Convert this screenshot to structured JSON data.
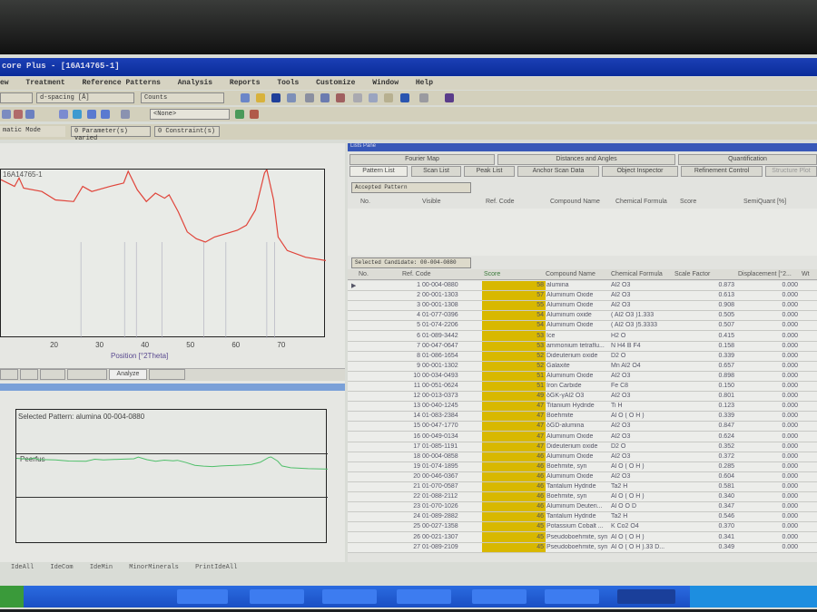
{
  "window": {
    "title": "core Plus - [16A14765-1]"
  },
  "menu": [
    "ew",
    "Treatment",
    "Reference Patterns",
    "Analysis",
    "Reports",
    "Tools",
    "Customize",
    "Window",
    "Help"
  ],
  "toolbar": {
    "dspacing": "d-spacing [Å]",
    "counts": "Counts",
    "none": "<None>",
    "mode": "matic Mode",
    "params": "0 Parameter(s) varied",
    "constraints": "0 Constraint(s)"
  },
  "scan_plot": {
    "sample": "16A14765-1",
    "xlabel": "Position [°2Theta]",
    "xticks": [
      20,
      30,
      40,
      50,
      60,
      70
    ],
    "xrange": [
      8,
      79.5
    ],
    "points": [
      [
        8,
        0.94
      ],
      [
        11,
        0.9
      ],
      [
        12,
        0.95
      ],
      [
        13,
        0.89
      ],
      [
        17,
        0.87
      ],
      [
        20,
        0.82
      ],
      [
        24,
        0.81
      ],
      [
        26,
        0.9
      ],
      [
        28,
        0.87
      ],
      [
        32,
        0.9
      ],
      [
        35,
        0.92
      ],
      [
        36,
        0.99
      ],
      [
        38,
        0.88
      ],
      [
        40,
        0.81
      ],
      [
        42,
        0.86
      ],
      [
        44,
        0.83
      ],
      [
        45,
        0.85
      ],
      [
        47,
        0.75
      ],
      [
        49,
        0.63
      ],
      [
        51,
        0.59
      ],
      [
        53,
        0.57
      ],
      [
        55,
        0.6
      ],
      [
        60,
        0.64
      ],
      [
        62,
        0.67
      ],
      [
        64,
        0.76
      ],
      [
        66,
        0.98
      ],
      [
        66.5,
        1.0
      ],
      [
        68,
        0.82
      ],
      [
        69,
        0.6
      ],
      [
        71,
        0.52
      ],
      [
        75,
        0.48
      ],
      [
        79.5,
        0.46
      ]
    ],
    "line_color": "#e0443a"
  },
  "left_tabs": {
    "analyze": "Analyze"
  },
  "pattern_panel": {
    "selected": "Selected Pattern: alumina 00-004-0880",
    "label": "Peerfus",
    "line_color": "#4fbf6a"
  },
  "bottom_toolbar": [
    "IdeAll",
    "IdeCom",
    "IdeMin",
    "MinorMinerals",
    "PrintIdeAll"
  ],
  "lists_pane": {
    "title": "Lists Pane",
    "tabs_row1": [
      "Fourier Map",
      "Distances and Angles",
      "Quantification"
    ],
    "tabs_row2": [
      "Pattern List",
      "Scan List",
      "Peak List",
      "Anchor Scan Data",
      "Object Inspector",
      "Refinement Control",
      "Structure Plot"
    ],
    "accepted": "Accepted Pattern",
    "accepted_cols": [
      "No.",
      "Visible",
      "Ref. Code",
      "Compound Name",
      "Chemical Formula",
      "Score",
      "SemiQuant [%]"
    ],
    "selected_candidate": "Selected Candidate: 00-004-0880",
    "cols": [
      "No.",
      "Ref. Code",
      "Score",
      "Compound Name",
      "Chemical Formula",
      "Scale Factor",
      "Displacement [°2...",
      "Wt"
    ],
    "score_color": "#d8b800",
    "rows": [
      [
        "1",
        "00-004-0880",
        "58",
        "alumina",
        "Al2 O3",
        "0.873",
        "0.000"
      ],
      [
        "2",
        "00-001-1303",
        "57",
        "Aluminum Oxide",
        "Al2 O3",
        "0.613",
        "0.000"
      ],
      [
        "3",
        "00-001-1308",
        "55",
        "Aluminum Oxide",
        "Al2 O3",
        "0.908",
        "0.000"
      ],
      [
        "4",
        "01-077-0396",
        "54",
        "Aluminum oxide",
        "( Al2 O3 )1.333",
        "0.505",
        "0.000"
      ],
      [
        "5",
        "01-074-2206",
        "54",
        "Aluminum Oxide",
        "( Al2 O3 )5.3333",
        "0.507",
        "0.000"
      ],
      [
        "6",
        "01-089-3442",
        "53",
        "Ice",
        "H2 O",
        "0.415",
        "0.000"
      ],
      [
        "7",
        "00-047-0647",
        "53",
        "ammonium tetraflu...",
        "N H4 B F4",
        "0.158",
        "0.000"
      ],
      [
        "8",
        "01-086-1654",
        "52",
        "Dideuterium oxide",
        "D2 O",
        "0.339",
        "0.000"
      ],
      [
        "9",
        "00-001-1302",
        "52",
        "Galaxite",
        "Mn Al2 O4",
        "0.657",
        "0.000"
      ],
      [
        "10",
        "00-034-0493",
        "51",
        "Aluminum Oxide",
        "Al2 O3",
        "0.898",
        "0.000"
      ],
      [
        "11",
        "00-051-0624",
        "51",
        "Iron Carbide",
        "Fe C8",
        "0.150",
        "0.000"
      ],
      [
        "12",
        "00-013-0373",
        "49",
        "δGK-γAl2 O3",
        "Al2 O3",
        "0.801",
        "0.000"
      ],
      [
        "13",
        "00-040-1245",
        "47",
        "Titanium Hydride",
        "Ti H",
        "0.123",
        "0.000"
      ],
      [
        "14",
        "01-083-2384",
        "47",
        "Boehmite",
        "Al O ( O H )",
        "0.339",
        "0.000"
      ],
      [
        "15",
        "00-047-1770",
        "47",
        "δGD-alumina",
        "Al2 O3",
        "0.847",
        "0.000"
      ],
      [
        "16",
        "00-049-0134",
        "47",
        "Aluminum Oxide",
        "Al2 O3",
        "0.624",
        "0.000"
      ],
      [
        "17",
        "01-085-1191",
        "47",
        "Dideuterium oxide",
        "D2 O",
        "0.352",
        "0.000"
      ],
      [
        "18",
        "00-004-0858",
        "46",
        "Aluminum Oxide",
        "Al2 O3",
        "0.372",
        "0.000"
      ],
      [
        "19",
        "01-074-1895",
        "46",
        "Boehmite, syn",
        "Al O ( O H )",
        "0.285",
        "0.000"
      ],
      [
        "20",
        "00-046-0367",
        "46",
        "Aluminum Oxide",
        "Al2 O3",
        "0.604",
        "0.000"
      ],
      [
        "21",
        "01-070-0587",
        "46",
        "Tantalum Hydride",
        "Ta2 H",
        "0.581",
        "0.000"
      ],
      [
        "22",
        "01-088-2112",
        "46",
        "Boehmite, syn",
        "Al O ( O H )",
        "0.340",
        "0.000"
      ],
      [
        "23",
        "01-070-1026",
        "46",
        "Aluminum Deuteri...",
        "Al O O D",
        "0.347",
        "0.000"
      ],
      [
        "24",
        "01-089-2882",
        "46",
        "Tantalum Hydride",
        "Ta2 H",
        "0.546",
        "0.000"
      ],
      [
        "25",
        "00-027-1358",
        "45",
        "Potassium Cobalt ...",
        "K Co2 O4",
        "0.370",
        "0.000"
      ],
      [
        "26",
        "00-021-1307",
        "45",
        "Pseudoboehmite, syn",
        "Al O ( O H )",
        "0.341",
        "0.000"
      ],
      [
        "27",
        "01-089-2109",
        "45",
        "Pseudoboehmite, syn",
        "Al O ( O H ).33 D...",
        "0.349",
        "0.000"
      ]
    ]
  }
}
